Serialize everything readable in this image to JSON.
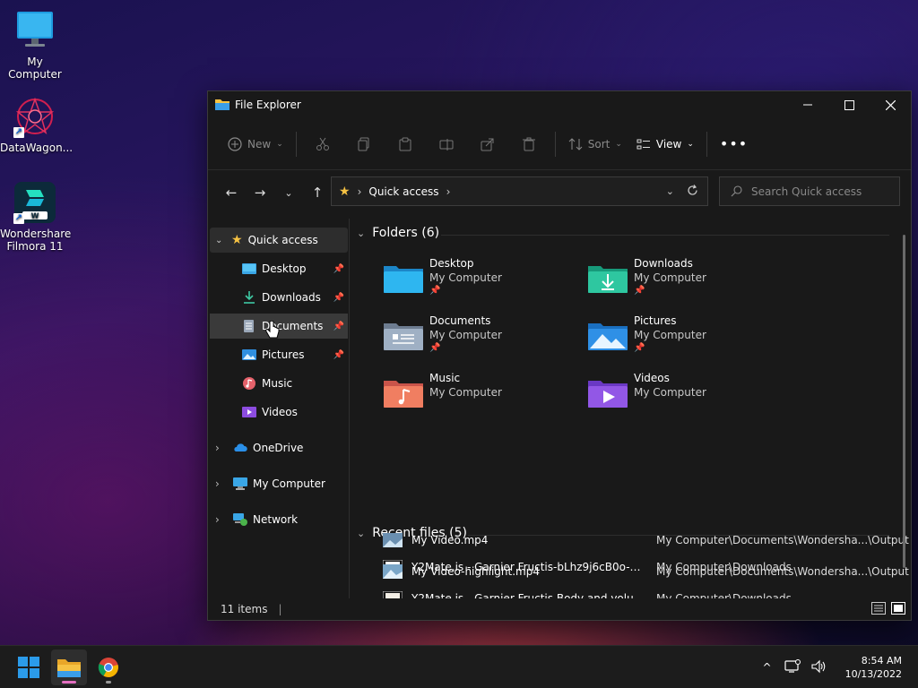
{
  "desktop": {
    "icons": [
      {
        "label": "My Computer"
      },
      {
        "label": "DataWagon..."
      },
      {
        "label": "Wondershare Filmora 11"
      }
    ]
  },
  "window": {
    "title": "File Explorer",
    "toolbar": {
      "new_label": "New",
      "sort_label": "Sort",
      "view_label": "View"
    },
    "address": {
      "crumb": "Quick access"
    },
    "search": {
      "placeholder": "Search Quick access"
    },
    "sidebar": {
      "quick_access": "Quick access",
      "pinned": [
        "Desktop",
        "Downloads",
        "Documents",
        "Pictures"
      ],
      "others": [
        "Music",
        "Videos"
      ],
      "onedrive": "OneDrive",
      "my_computer": "My Computer",
      "network": "Network"
    },
    "folders_header": "Folders (6)",
    "folders": [
      {
        "name": "Desktop",
        "location": "My Computer",
        "pinned": true
      },
      {
        "name": "Downloads",
        "location": "My Computer",
        "pinned": true
      },
      {
        "name": "Documents",
        "location": "My Computer",
        "pinned": true
      },
      {
        "name": "Pictures",
        "location": "My Computer",
        "pinned": true
      },
      {
        "name": "Music",
        "location": "My Computer",
        "pinned": false
      },
      {
        "name": "Videos",
        "location": "My Computer",
        "pinned": false
      }
    ],
    "recent_header": "Recent files (5)",
    "recent": [
      {
        "name": "Y2Mate.is - Garnier Fructis-bLhz9j6cB0o-144p-1...",
        "location": "My Computer\\Downloads"
      },
      {
        "name": "Y2Mate.is - Garnier Fructis Body and volume  2...",
        "location": "My Computer\\Downloads"
      },
      {
        "name": "My Video.mp4",
        "location": "My Computer\\Documents\\Wondersha...\\Output"
      },
      {
        "name": "My Video-highlight.mp4",
        "location": "My Computer\\Documents\\Wondersha...\\Output"
      }
    ],
    "status": "11 items"
  },
  "taskbar": {
    "time": "8:54 AM",
    "date": "10/13/2022"
  },
  "colors": {
    "accent_blue": "#4cc2ff",
    "folder_yellow": "#f6c243",
    "window_bg": "#191919"
  }
}
